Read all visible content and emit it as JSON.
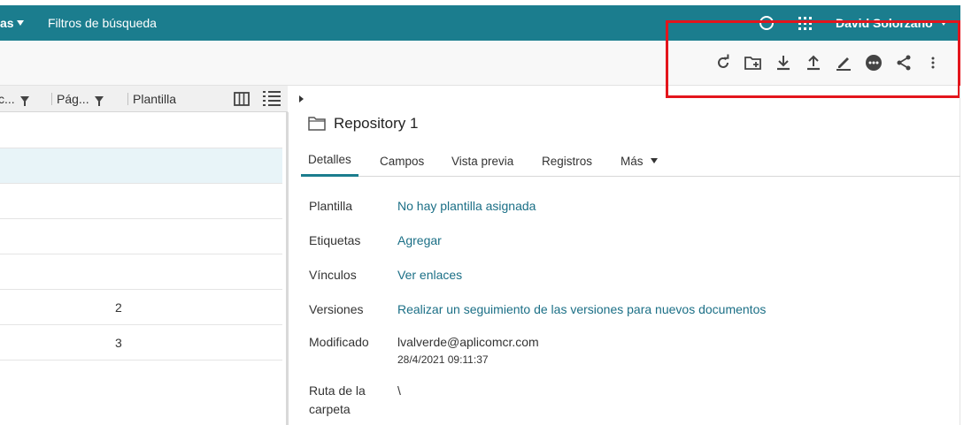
{
  "topbar": {
    "menu_partial": "as",
    "search_filters": "Filtros de búsqueda",
    "user_name": "David Solorzano"
  },
  "toolbar": {
    "icons": [
      "refresh-icon",
      "new-folder-icon",
      "download-icon",
      "upload-icon",
      "sign-icon",
      "more-circle-icon",
      "share-icon",
      "vertical-ellipsis-icon"
    ]
  },
  "list": {
    "columns": [
      "c...",
      "Pág...",
      "Plantilla"
    ],
    "rows": [
      {
        "value": ""
      },
      {
        "value": ""
      },
      {
        "value": ""
      },
      {
        "value": ""
      },
      {
        "value": ""
      },
      {
        "value": "2"
      },
      {
        "value": "3"
      }
    ]
  },
  "details": {
    "title": "Repository 1",
    "tabs": [
      "Detalles",
      "Campos",
      "Vista previa",
      "Registros",
      "Más"
    ],
    "properties": {
      "template_label": "Plantilla",
      "template_value": "No hay plantilla asignada",
      "tags_label": "Etiquetas",
      "tags_value": "Agregar",
      "links_label": "Vínculos",
      "links_value": "Ver enlaces",
      "versions_label": "Versiones",
      "versions_value": "Realizar un seguimiento de las versiones para nuevos documentos",
      "modified_label": "Modificado",
      "modified_user": "lvalverde@aplicomcr.com",
      "modified_date": "28/4/2021 09:11:37",
      "path_label_1": "Ruta de la",
      "path_label_2": "carpeta",
      "path_value": "\\"
    }
  },
  "colors": {
    "header_bg": "#1b7d8e",
    "link": "#1b6f86",
    "highlight": "#e3151c",
    "selected_row": "#e8f4f8"
  }
}
